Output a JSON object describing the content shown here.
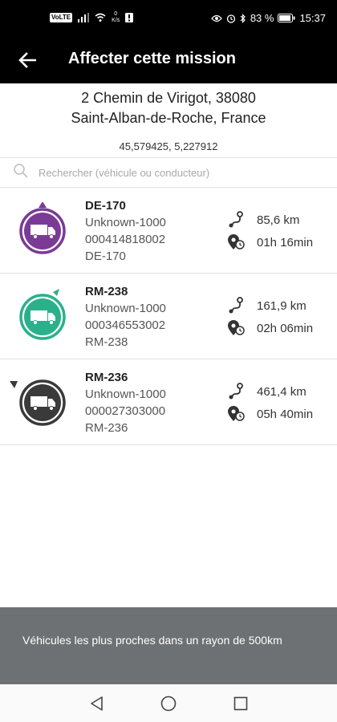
{
  "status_bar": {
    "network_chip": "VoLTE",
    "speed_value": "0",
    "speed_unit": "K/s",
    "battery": "83 %",
    "time": "15:37"
  },
  "header": {
    "title": "Affecter cette mission"
  },
  "address": {
    "line1": "2 Chemin de Virigot, 38080",
    "line2": "Saint-Alban-de-Roche, France",
    "coordinates": "45,579425, 5,227912"
  },
  "search": {
    "placeholder": "Rechercher (véhicule ou conducteur)"
  },
  "vehicles": [
    {
      "name": "DE-170",
      "driver": "Unknown-1000",
      "id_number": "000414818002",
      "plate": "DE-170",
      "distance": "85,6 km",
      "duration": "01h 16min",
      "color": "#7b3a96",
      "heading": "north"
    },
    {
      "name": "RM-238",
      "driver": "Unknown-1000",
      "id_number": "000346553002",
      "plate": "RM-238",
      "distance": "161,9 km",
      "duration": "02h 06min",
      "color": "#2bb08c",
      "heading": "north-east"
    },
    {
      "name": "RM-236",
      "driver": "Unknown-1000",
      "id_number": "000027303000",
      "plate": "RM-236",
      "distance": "461,4 km",
      "duration": "05h 40min",
      "color": "#3a3a3a",
      "heading": "south-west"
    }
  ],
  "footer": {
    "text": "Véhicules les plus proches dans un rayon de 500km"
  },
  "icons": {
    "back": "arrow-left-icon",
    "search": "search-icon",
    "truck": "truck-icon",
    "distance": "route-icon",
    "duration": "location-time-icon",
    "nav_back": "triangle-back-icon",
    "nav_home": "circle-home-icon",
    "nav_recent": "square-recent-icon"
  }
}
